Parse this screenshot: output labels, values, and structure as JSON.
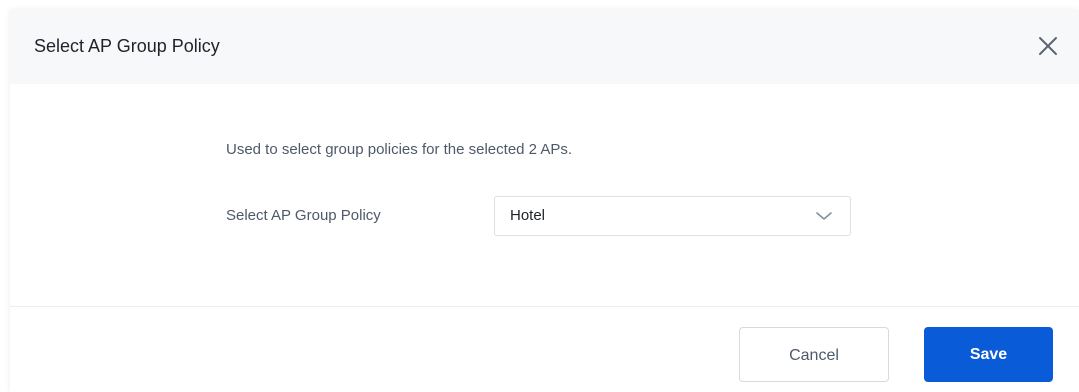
{
  "dialog": {
    "title": "Select AP Group Policy",
    "close_icon": "close-icon"
  },
  "content": {
    "description": "Used to select group policies for the selected 2 APs.",
    "field_label": "Select AP Group Policy",
    "select_value": "Hotel",
    "select_icon": "chevron-down-icon"
  },
  "footer": {
    "cancel_label": "Cancel",
    "save_label": "Save"
  },
  "colors": {
    "header_bg": "#f7f8fa",
    "primary": "#0a5bd8",
    "text": "#1f2329",
    "secondary_text": "#4e5969"
  }
}
